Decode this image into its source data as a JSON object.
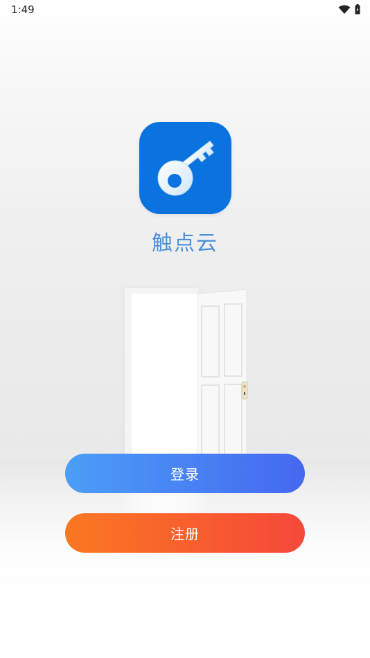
{
  "status_bar": {
    "time": "1:49",
    "icons": [
      "wifi-icon",
      "battery-icon"
    ]
  },
  "app": {
    "name": "触点云",
    "logo_icon": "key-icon",
    "logo_color": "#0a73df",
    "name_color": "#4a90d9"
  },
  "illustration": {
    "icon": "open-door-illustration"
  },
  "actions": {
    "login_label": "登录",
    "register_label": "注册",
    "login_gradient": [
      "#4b9ef7",
      "#4568f0"
    ],
    "register_gradient": [
      "#fb7822",
      "#f5483a"
    ]
  }
}
